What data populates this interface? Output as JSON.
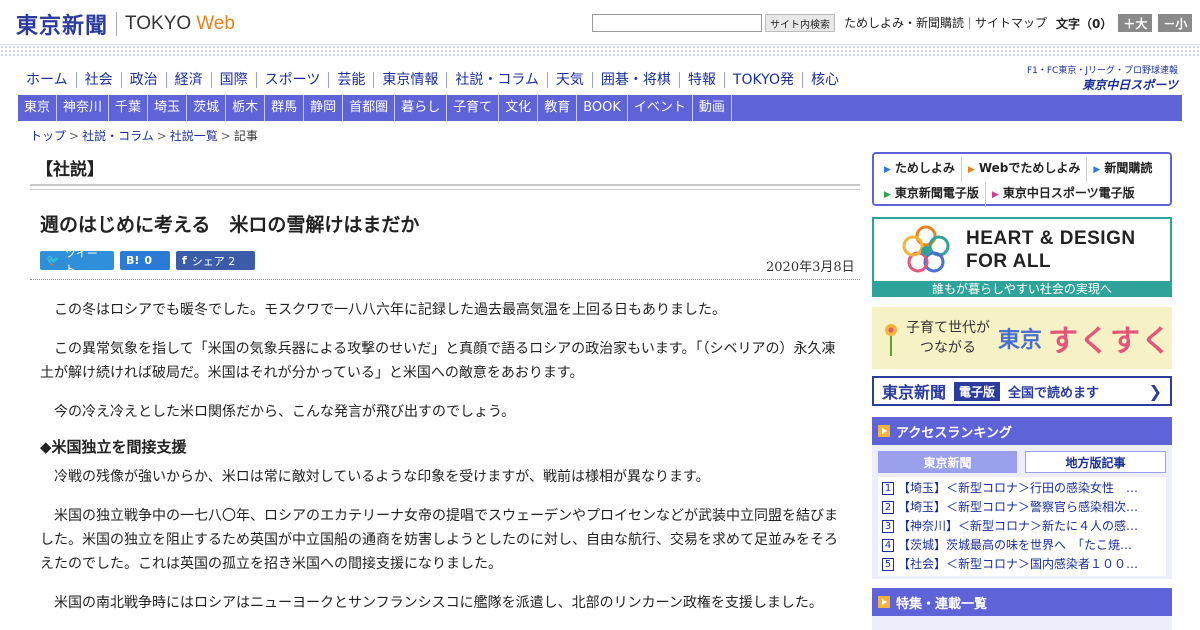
{
  "header": {
    "logo_jp": "東京新聞",
    "logo_tokyo": "TOKYO",
    "logo_web": "Web",
    "search_button": "サイト内検索",
    "links": [
      "ためしよみ・新聞購読",
      "サイトマップ"
    ],
    "font_size_label": "文字（0）",
    "font_plus": "＋大",
    "font_minus": "－小"
  },
  "nav_main": [
    "ホーム",
    "社会",
    "政治",
    "経済",
    "国際",
    "スポーツ",
    "芸能",
    "東京情報",
    "社説・コラム",
    "天気",
    "囲碁・将棋",
    "特報",
    "TOKYO発",
    "核心"
  ],
  "chunichi": {
    "top": "F1・FC東京・Jリーグ・プロ野球速報",
    "bottom": "東京中日スポーツ"
  },
  "nav_region": [
    "東京",
    "神奈川",
    "千葉",
    "埼玉",
    "茨城",
    "栃木",
    "群馬",
    "静岡",
    "首都圏",
    "暮らし",
    "子育て",
    "文化",
    "教育",
    "BOOK",
    "イベント",
    "動画"
  ],
  "breadcrumb": [
    "トップ",
    "社説・コラム",
    "社説一覧",
    "記事"
  ],
  "article": {
    "section": "【社説】",
    "headline": "週のはじめに考える　米ロの雪解けはまだか",
    "share": {
      "tweet": "ツイート",
      "hatena": "0",
      "facebook": "シェア 2"
    },
    "date": "2020年3月8日",
    "paragraphs": [
      "この冬はロシアでも暖冬でした。モスクワで一八八六年に記録した過去最高気温を上回る日もありました。",
      "この異常気象を指して「米国の気象兵器による攻撃のせいだ」と真顔で語るロシアの政治家もいます。「（シベリアの）永久凍土が解け続ければ破局だ。米国はそれが分かっている」と米国への敵意をあおります。",
      "今の冷え冷えとした米ロ関係だから、こんな発言が飛び出すのでしょう。"
    ],
    "subhead": "◆米国独立を間接支援",
    "paragraphs2": [
      "冷戦の残像が強いからか、米ロは常に敵対しているような印象を受けますが、戦前は様相が異なります。",
      "米国の独立戦争中の一七八〇年、ロシアのエカテリーナ女帝の提唱でスウェーデンやプロイセンなどが武装中立同盟を結びました。米国の独立を阻止するため英国が中立国船の通商を妨害しようとしたのに対し、自由な航行、交易を求めて足並みをそろえたのでした。これは英国の孤立を招き米国への間接支援になりました。",
      "米国の南北戦争時にはロシアはニューヨークとサンフランシスコに艦隊を派遣し、北部のリンカーン政権を支援しました。"
    ]
  },
  "sidebar": {
    "quick": [
      "ためしよみ",
      "Webでためしよみ",
      "新聞購読",
      "東京新聞電子版",
      "東京中日スポーツ電子版"
    ],
    "heart": {
      "line1": "HEART & DESIGN",
      "line2": "FOR ALL",
      "sub": "誰もが暮らしやすい社会の実現へ"
    },
    "sukusuku": {
      "small1": "子育て世代が",
      "small2": "つながる",
      "tokyo": "東京",
      "big": "すくすく"
    },
    "denshi": {
      "logo": "東京新聞",
      "badge": "電子版",
      "text": "全国で読めます"
    },
    "ranking": {
      "title": "アクセスランキング",
      "tabs": [
        "東京新聞",
        "地方版記事"
      ],
      "items": [
        "【埼玉】＜新型コロナ＞行田の感染女性　…",
        "【埼玉】＜新型コロナ＞警察官ら感染相次…",
        "【神奈川】＜新型コロナ＞新たに４人の感…",
        "【茨城】茨城最高の味を世界へ　「たこ焼…",
        "【社会】＜新型コロナ＞国内感染者１００…"
      ]
    },
    "feature_title": "特集・連載一覧"
  },
  "colors": {
    "brand": "#2b3c9c",
    "nav": "#5f63d8",
    "accent": "#e8821e",
    "heart": "#2fa39a"
  }
}
